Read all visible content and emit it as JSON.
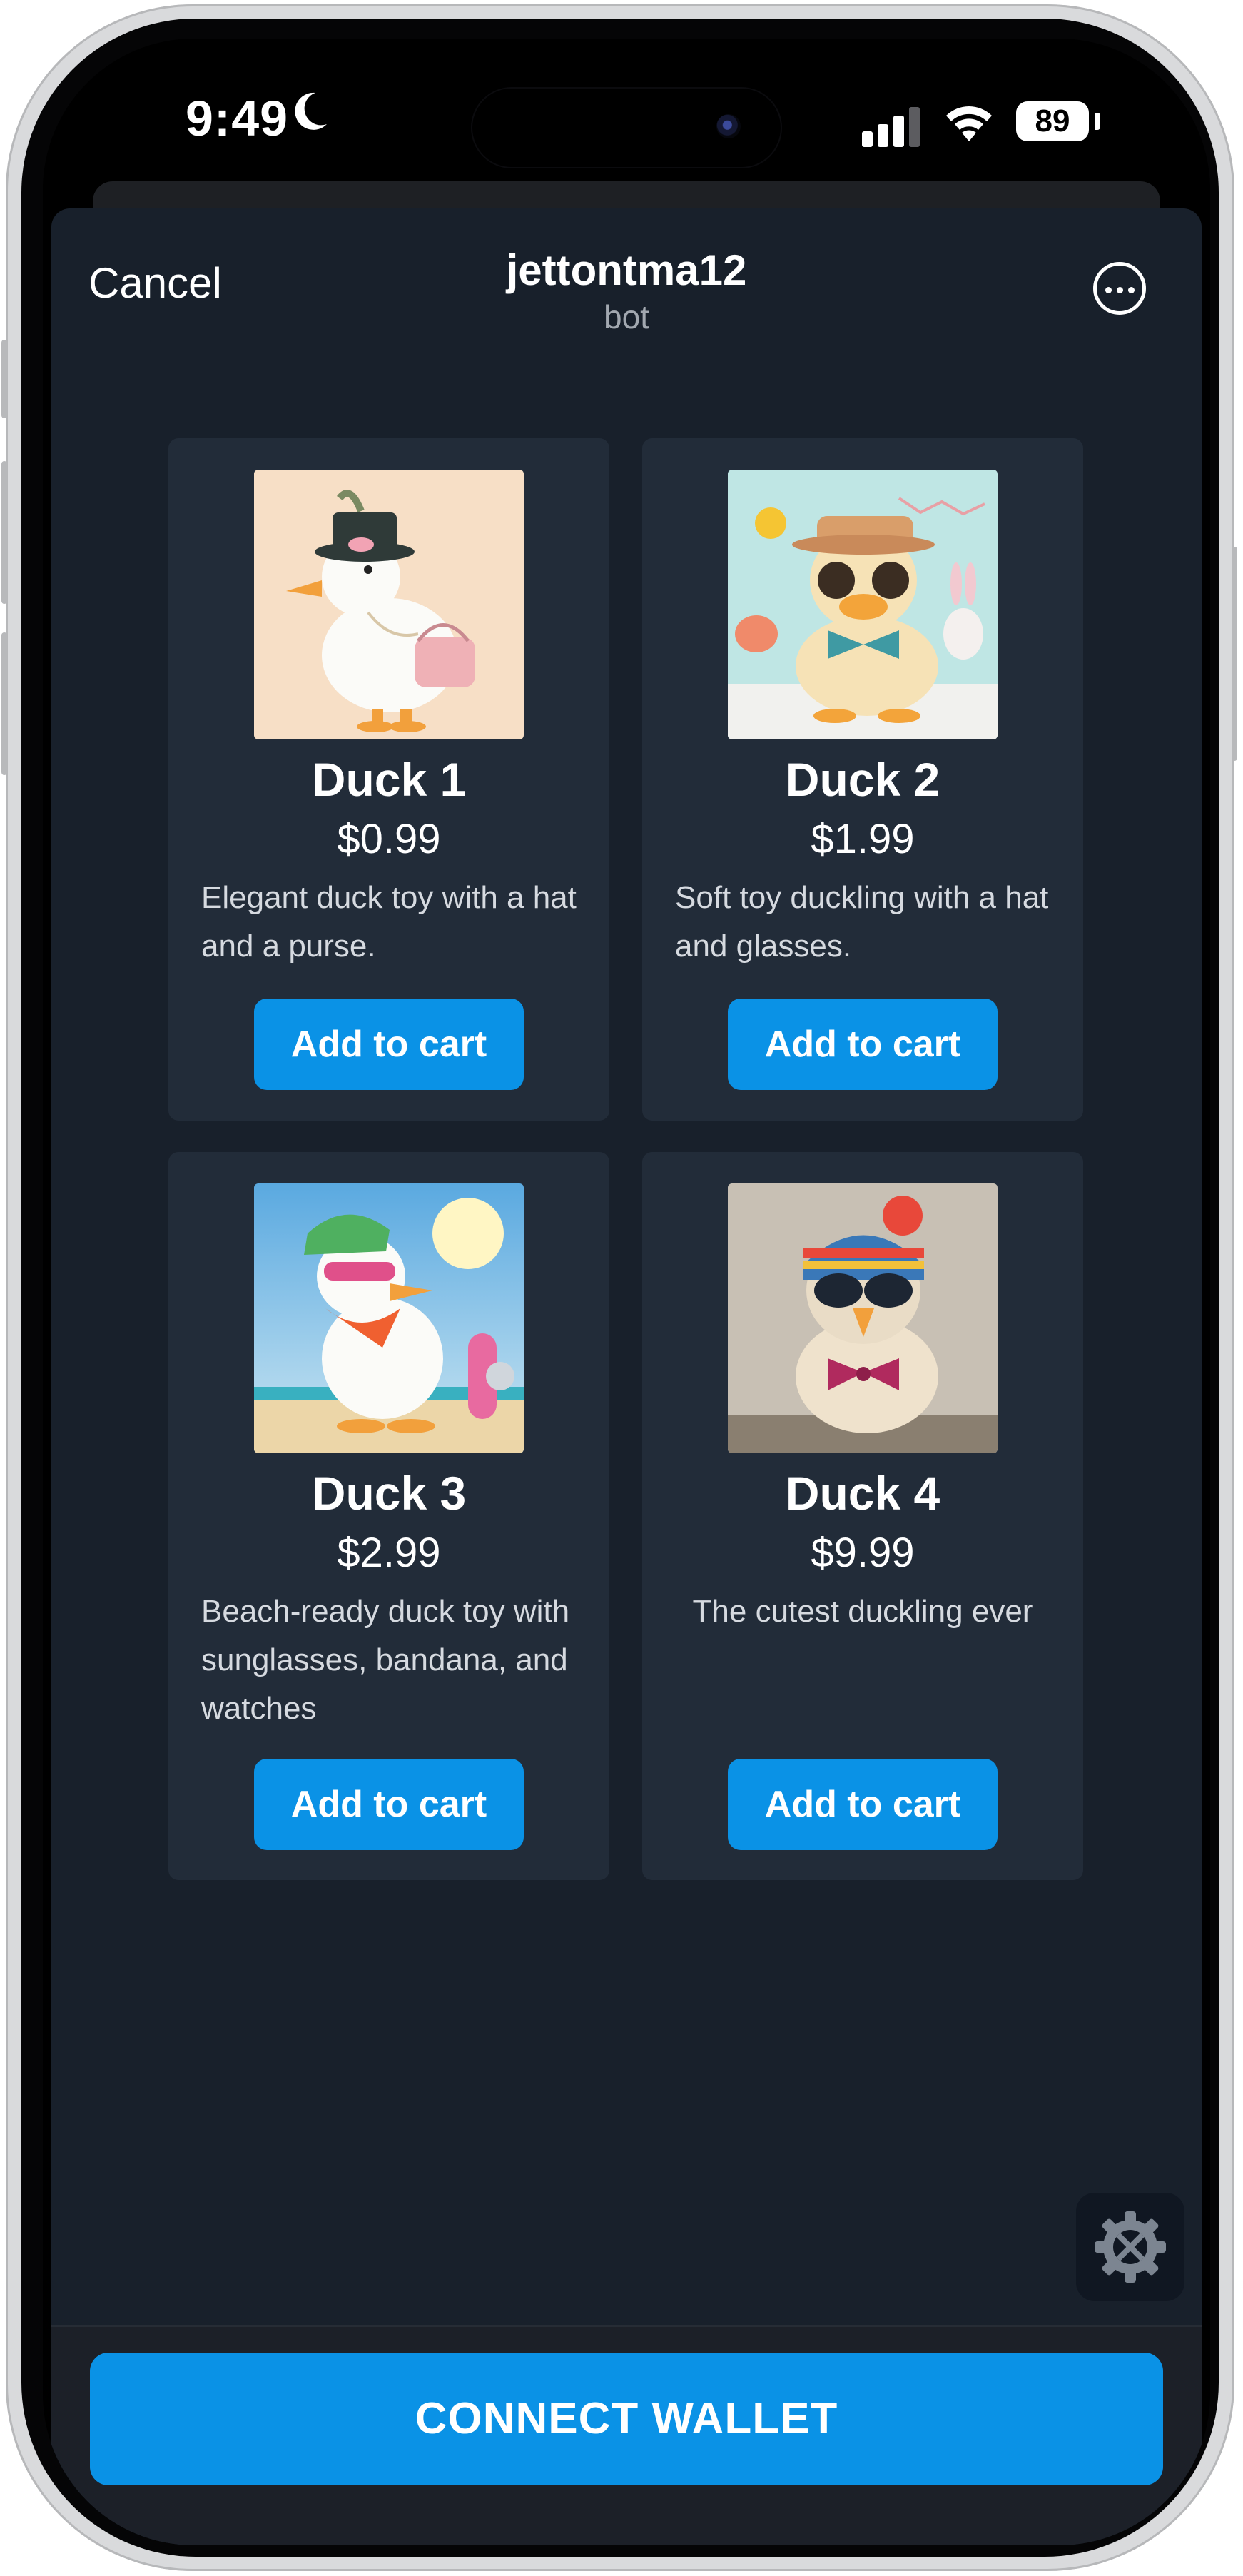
{
  "status_bar": {
    "time": "9:49",
    "battery": "89"
  },
  "header": {
    "cancel_label": "Cancel",
    "title": "jettontma12",
    "subtitle": "bot"
  },
  "products": [
    {
      "name": "Duck 1",
      "price": "$0.99",
      "description": "Elegant duck toy with a hat and a purse.",
      "button": "Add to cart"
    },
    {
      "name": "Duck 2",
      "price": "$1.99",
      "description": "Soft toy duckling with a hat and glasses.",
      "button": "Add to cart"
    },
    {
      "name": "Duck 3",
      "price": "$2.99",
      "description": "Beach-ready duck toy with sunglasses, bandana, and watches",
      "button": "Add to cart"
    },
    {
      "name": "Duck 4",
      "price": "$9.99",
      "description": "The cutest duckling ever",
      "button": "Add to cart"
    }
  ],
  "main_button": {
    "label": "CONNECT WALLET"
  },
  "colors": {
    "accent": "#0a92e6",
    "background": "#18202b",
    "card": "#222c39"
  },
  "icons": [
    "moon-icon",
    "signal-icon",
    "wifi-icon",
    "battery-icon",
    "more-icon",
    "settings-icon"
  ]
}
